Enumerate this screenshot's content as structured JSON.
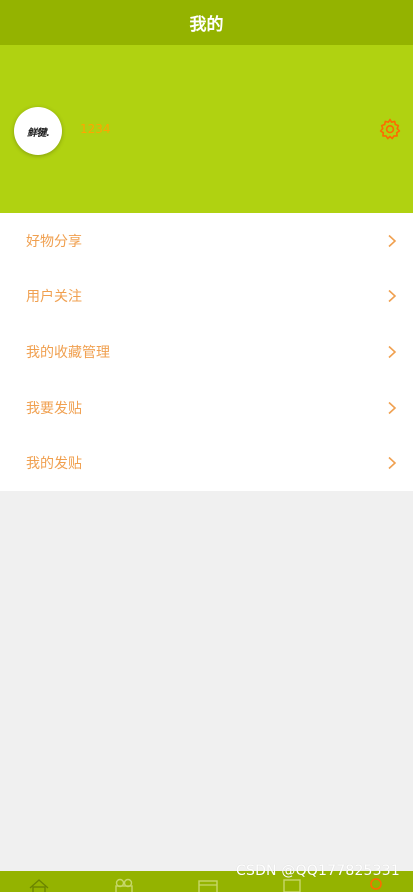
{
  "header": {
    "title": "我的"
  },
  "profile": {
    "avatar_text": "鲜犍.",
    "username": "1234"
  },
  "menu": {
    "items": [
      {
        "label": "好物分享"
      },
      {
        "label": "用户关注"
      },
      {
        "label": "我的收藏管理"
      },
      {
        "label": "我要发贴"
      },
      {
        "label": "我的发贴"
      }
    ]
  },
  "tabbar": {
    "icons": [
      "home-icon",
      "gift-icon",
      "calendar-icon",
      "message-icon",
      "user-icon"
    ]
  },
  "watermark": {
    "text": "CSDN @QQ177825331"
  },
  "colors": {
    "nav": "#94b300",
    "profile_bg": "#b0d211",
    "accent": "#ffa500",
    "menu_text": "#f0a050",
    "page_bg": "#f0f0f0"
  }
}
